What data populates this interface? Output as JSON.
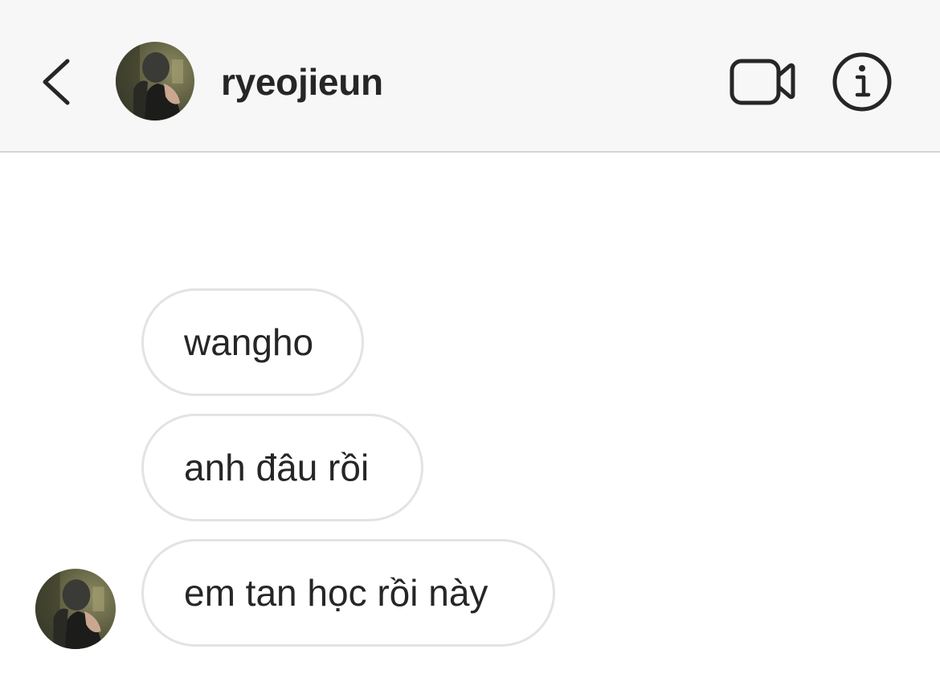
{
  "header": {
    "back_icon": "chevron-left-icon",
    "username": "ryeojieun",
    "avatar_icon": "profile-photo",
    "video_icon": "video-camera-icon",
    "info_icon": "info-circle-icon"
  },
  "messages": [
    {
      "text": "wangho",
      "sender": "ryeojieun"
    },
    {
      "text": "anh đâu rồi",
      "sender": "ryeojieun"
    },
    {
      "text": "em tan học rồi này",
      "sender": "ryeojieun"
    }
  ],
  "colors": {
    "header_bg": "#f7f7f7",
    "bubble_border": "#e3e3e3",
    "text": "#262626",
    "divider": "#d4d4d4"
  }
}
